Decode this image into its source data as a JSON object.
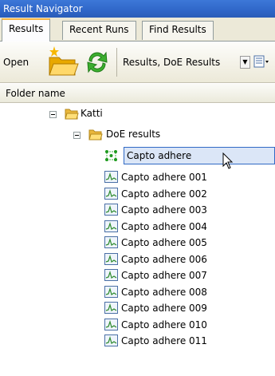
{
  "window": {
    "title": "Result Navigator"
  },
  "tabs": [
    {
      "label": "Results",
      "active": true
    },
    {
      "label": "Recent Runs",
      "active": false
    },
    {
      "label": "Find Results",
      "active": false
    }
  ],
  "toolbar": {
    "open_label": "Open",
    "filter_label": "Results, DoE Results",
    "icons": [
      "open-folder-icon",
      "refresh-icon",
      "dropdown-arrow-icon",
      "view-options-icon"
    ]
  },
  "column_header": "Folder name",
  "tree": {
    "root": {
      "label": "Katti",
      "icon": "folder-icon",
      "expanded": true
    },
    "folder": {
      "label": "DoE results",
      "icon": "folder-icon",
      "expanded": true
    },
    "selected_item": {
      "label": "Capto adhere",
      "icon": "doe-design-icon"
    },
    "items": [
      "Capto adhere 001",
      "Capto adhere 002",
      "Capto adhere 003",
      "Capto adhere 004",
      "Capto adhere 005",
      "Capto adhere 006",
      "Capto adhere 007",
      "Capto adhere 008",
      "Capto adhere 009",
      "Capto adhere 010",
      "Capto adhere 011"
    ]
  },
  "colors": {
    "titlebar": "#2f66c8",
    "selection_fill": "#dbe6f7",
    "selection_border": "#316ac5",
    "active_tab_accent": "#f5b546"
  }
}
